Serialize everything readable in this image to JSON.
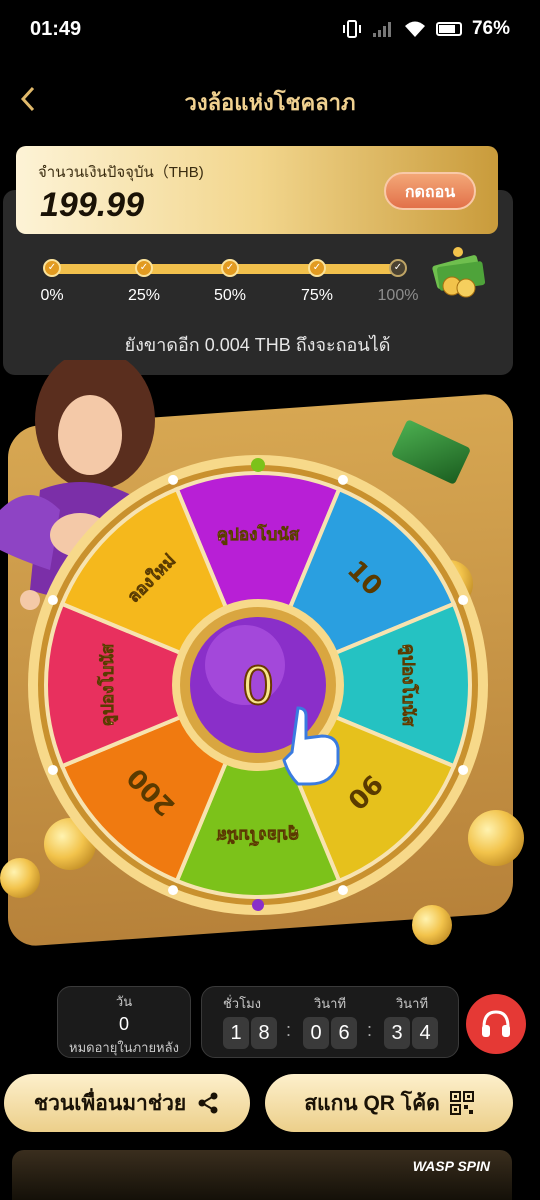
{
  "status": {
    "time": "01:49",
    "battery": "76%"
  },
  "header": {
    "title": "วงล้อแห่งโชคลาภ",
    "back_icon": "chevron-left-icon"
  },
  "balance": {
    "label": "จำนวนเงินปัจจุบัน（THB)",
    "value": "199.99",
    "withdraw_label": "กดถอน"
  },
  "progress": {
    "value": 1.0,
    "milestones": [
      "0%",
      "25%",
      "50%",
      "75%",
      "100%"
    ],
    "remaining_text": "ยังขาดอีก 0.004 THB ถึงจะถอนได้"
  },
  "wheel": {
    "center_value": "0",
    "segments": [
      "คูปองโบนัส",
      "10",
      "คูปองโบนัส",
      "90",
      "คูปองโบนัส",
      "200",
      "คูปองโบนัส",
      "ลองใหม่"
    ],
    "colors": [
      "#b81fd6",
      "#2a9fe0",
      "#25c2c2",
      "#e6c11c",
      "#7cc21a",
      "#f07a10",
      "#e8305e",
      "#f5b81c"
    ]
  },
  "countdown": {
    "days_label": "วัน",
    "days_value": "0",
    "days_caption": "หมดอายุในภายหลัง",
    "hours_label": "ชั่วโมง",
    "minutes_label": "วินาที",
    "seconds_label": "วินาที",
    "h1": "1",
    "h2": "8",
    "m1": "0",
    "m2": "6",
    "s1": "3",
    "s2": "4"
  },
  "actions": {
    "invite_label": "ชวนเพื่อนมาช่วย",
    "scan_label": "สแกน QR โค้ด"
  },
  "banner": {
    "text": "WASP SPIN"
  },
  "accent_colors": {
    "gold": "#f0d190",
    "support": "#e53935"
  }
}
